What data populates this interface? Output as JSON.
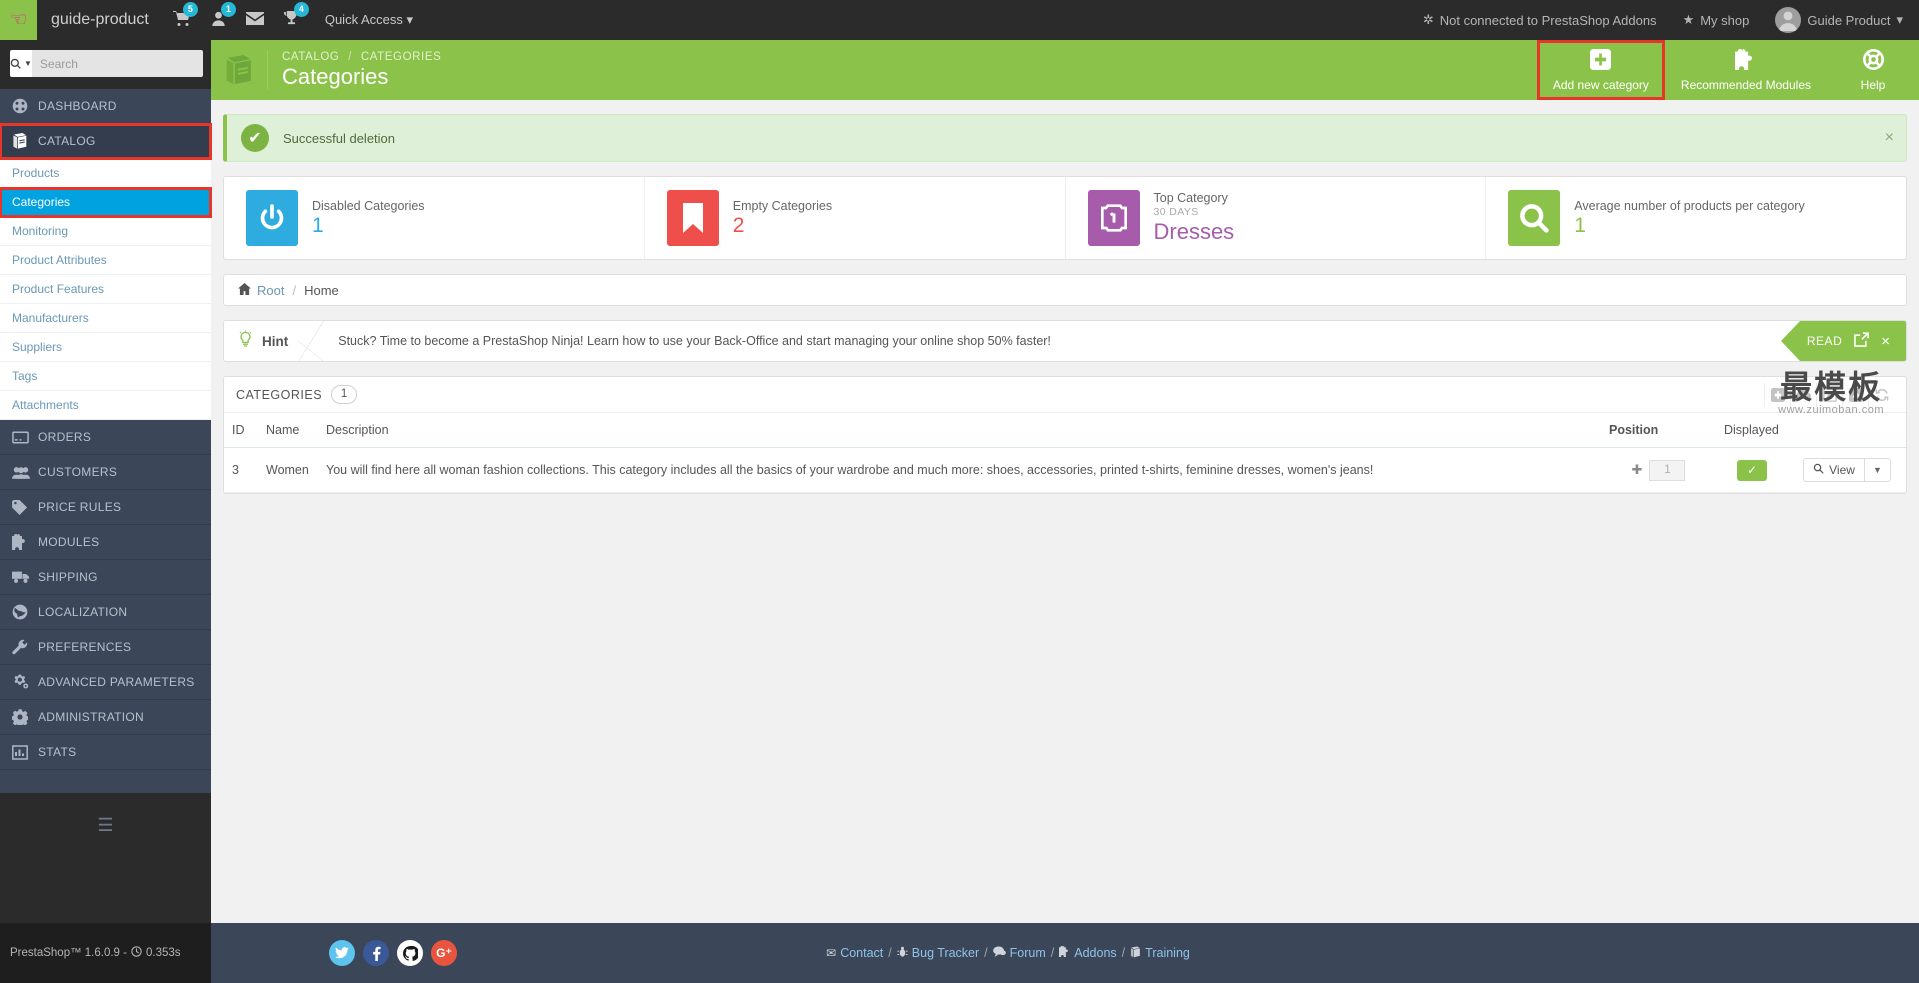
{
  "topbar": {
    "logo_icon": "hand-pointer-icon",
    "shop_name": "guide-product",
    "icons": [
      {
        "name": "cart-icon",
        "glyph": "Ὥ2",
        "badge": "5"
      },
      {
        "name": "customers-icon",
        "glyph": "person",
        "badge": "1"
      },
      {
        "name": "messages-icon",
        "glyph": "envelope",
        "badge": ""
      },
      {
        "name": "trophy-icon",
        "glyph": "trophy",
        "badge": "4"
      }
    ],
    "quick_access": "Quick Access",
    "addons_status": "Not connected to PrestaShop Addons",
    "my_shop": "My shop",
    "user_name": "Guide Product"
  },
  "sidebar": {
    "search_placeholder": "Search",
    "search_value": "",
    "items": [
      {
        "label": "DASHBOARD",
        "icon": "dashboard-icon",
        "active": false
      },
      {
        "label": "CATALOG",
        "icon": "catalog-book-icon",
        "active": true
      },
      {
        "label": "ORDERS",
        "icon": "orders-card-icon",
        "active": false
      },
      {
        "label": "CUSTOMERS",
        "icon": "customers-icon",
        "active": false
      },
      {
        "label": "PRICE RULES",
        "icon": "price-tag-icon",
        "active": false
      },
      {
        "label": "MODULES",
        "icon": "puzzle-icon",
        "active": false
      },
      {
        "label": "SHIPPING",
        "icon": "truck-icon",
        "active": false
      },
      {
        "label": "LOCALIZATION",
        "icon": "globe-icon",
        "active": false
      },
      {
        "label": "PREFERENCES",
        "icon": "wrench-icon",
        "active": false
      },
      {
        "label": "ADVANCED PARAMETERS",
        "icon": "cogs-icon",
        "active": false
      },
      {
        "label": "ADMINISTRATION",
        "icon": "gear-icon",
        "active": false
      },
      {
        "label": "STATS",
        "icon": "bar-chart-icon",
        "active": false
      }
    ],
    "catalog_submenu": [
      {
        "label": "Products",
        "active": false
      },
      {
        "label": "Categories",
        "active": true
      },
      {
        "label": "Monitoring",
        "active": false
      },
      {
        "label": "Product Attributes",
        "active": false
      },
      {
        "label": "Product Features",
        "active": false
      },
      {
        "label": "Manufacturers",
        "active": false
      },
      {
        "label": "Suppliers",
        "active": false
      },
      {
        "label": "Tags",
        "active": false
      },
      {
        "label": "Attachments",
        "active": false
      }
    ]
  },
  "page_header": {
    "icon": "catalog-book-icon",
    "breadcrumb_parent": "CATALOG",
    "breadcrumb_current": "CATEGORIES",
    "title": "Categories",
    "actions": [
      {
        "label": "Add new category",
        "icon": "plus-square-icon",
        "highlighted": true
      },
      {
        "label": "Recommended Modules",
        "icon": "puzzle-icon",
        "highlighted": false
      },
      {
        "label": "Help",
        "icon": "life-ring-icon",
        "highlighted": false
      }
    ]
  },
  "alert": {
    "icon": "check-circle-icon",
    "text": "Successful deletion",
    "close_icon": "close-icon"
  },
  "kpis": [
    {
      "label": "Disabled Categories",
      "sub": "",
      "value": "1",
      "icon": "power-icon",
      "bg": "#2eabdf",
      "value_color": "#2eabdf"
    },
    {
      "label": "Empty Categories",
      "sub": "",
      "value": "2",
      "icon": "bookmark-icon",
      "bg": "#ef4f4a",
      "value_color": "#ef4f4a"
    },
    {
      "label": "Top Category",
      "sub": "30 DAYS",
      "value": "Dresses",
      "icon": "badge-one-icon",
      "bg": "#a75cab",
      "value_color": "#a75cab"
    },
    {
      "label": "Average number of products per category",
      "sub": "",
      "value": "1",
      "icon": "magnifier-icon",
      "bg": "#8bc34a",
      "value_color": "#8bc34a"
    }
  ],
  "category_path": {
    "home_icon": "home-icon",
    "root": "Root",
    "separator": "/",
    "current": "Home"
  },
  "hint": {
    "bulb_icon": "lightbulb-icon",
    "label": "Hint",
    "text": "Stuck? Time to become a PrestaShop Ninja! Learn how to use your Back-Office and start managing your online shop 50% faster!",
    "read_label": "READ",
    "external_icon": "external-link-icon",
    "close_icon": "close-icon"
  },
  "table": {
    "title": "CATEGORIES",
    "count": "1",
    "tools": [
      {
        "name": "add-icon",
        "glyph": "+"
      },
      {
        "name": "export-cloud-icon",
        "glyph": "cloud"
      },
      {
        "name": "edit-icon",
        "glyph": "pencil"
      },
      {
        "name": "import-share-icon",
        "glyph": "share"
      },
      {
        "name": "refresh-icon",
        "glyph": "refresh"
      }
    ],
    "columns": [
      "ID",
      "Name",
      "Description",
      "Position",
      "Displayed",
      ""
    ],
    "rows": [
      {
        "id": "3",
        "name": "Women",
        "description": "You will find here all woman fashion collections. This category includes all the basics of your wardrobe and much more: shoes, accessories, printed t-shirts, feminine dresses, women's jeans!",
        "position": "1",
        "displayed": true,
        "action_label": "View"
      }
    ]
  },
  "watermark": {
    "text_cn": "最模板",
    "url": "www.zuimoban.com"
  },
  "footer": {
    "social": [
      {
        "name": "twitter-icon",
        "bg": "#5ec3ee",
        "glyph": "t"
      },
      {
        "name": "facebook-icon",
        "bg": "#3b5998",
        "glyph": "f"
      },
      {
        "name": "github-icon",
        "bg": "#ffffff",
        "glyph": "g"
      },
      {
        "name": "google-plus-icon",
        "bg": "#e9543f",
        "glyph": "G+"
      }
    ],
    "links": [
      {
        "label": "Contact",
        "icon": "envelope-icon"
      },
      {
        "label": "Bug Tracker",
        "icon": "bug-icon"
      },
      {
        "label": "Forum",
        "icon": "comment-icon"
      },
      {
        "label": "Addons",
        "icon": "puzzle-icon"
      },
      {
        "label": "Training",
        "icon": "book-icon"
      }
    ],
    "separator": "/",
    "version": "PrestaShop™ 1.6.0.9 -",
    "load_time": "0.353s",
    "clock_icon": "clock-icon"
  }
}
